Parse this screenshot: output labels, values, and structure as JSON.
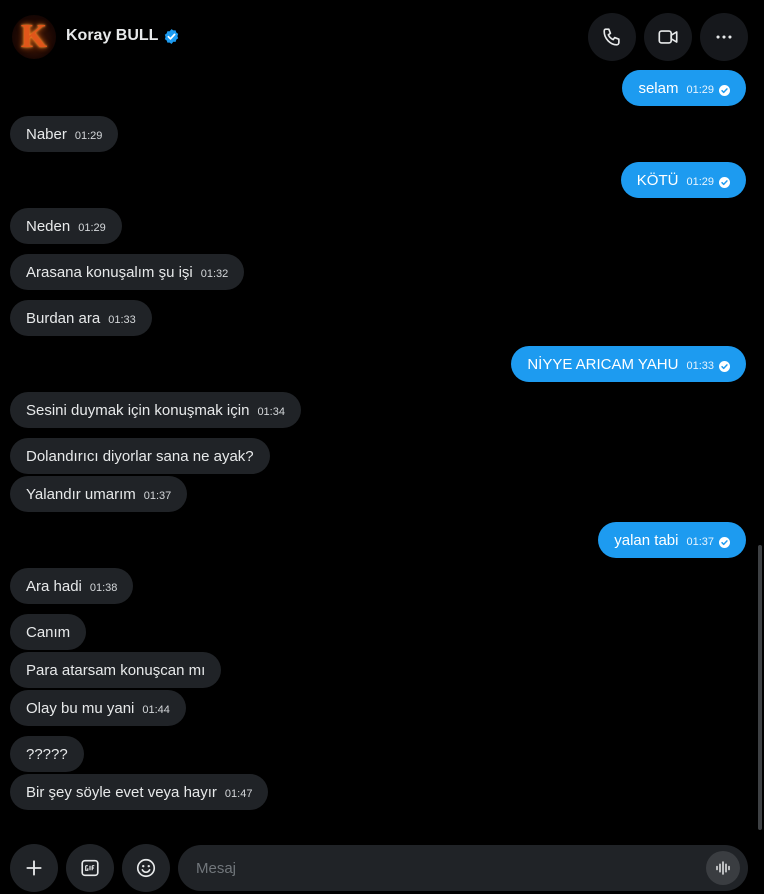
{
  "header": {
    "contact_name": "Koray BULL",
    "avatar_letter": "K"
  },
  "messages": [
    {
      "dir": "out",
      "text": "selam",
      "time": "01:29",
      "read": true
    },
    {
      "dir": "in",
      "text": "Naber",
      "time": "01:29"
    },
    {
      "dir": "out",
      "text": "KÖTÜ",
      "time": "01:29",
      "read": true
    },
    {
      "dir": "in",
      "text": "Neden",
      "time": "01:29"
    },
    {
      "dir": "in",
      "text": "Arasana konuşalım şu işi",
      "time": "01:32"
    },
    {
      "dir": "in",
      "text": "Burdan ara",
      "time": "01:33"
    },
    {
      "dir": "out",
      "text": "NİYYE ARICAM YAHU",
      "time": "01:33",
      "read": true
    },
    {
      "dir": "in",
      "text": "Sesini duymak için konuşmak için",
      "time": "01:34"
    },
    {
      "dir": "in",
      "text": "Dolandırıcı diyorlar sana ne ayak?",
      "time": ""
    },
    {
      "dir": "in",
      "text": "Yalandır umarım",
      "time": "01:37"
    },
    {
      "dir": "out",
      "text": "yalan tabi",
      "time": "01:37",
      "read": true
    },
    {
      "dir": "in",
      "text": "Ara hadi",
      "time": "01:38"
    },
    {
      "dir": "in",
      "text": "Canım",
      "time": ""
    },
    {
      "dir": "in",
      "text": "Para atarsam konuşcan mı",
      "time": ""
    },
    {
      "dir": "in",
      "text": "Olay bu mu yani",
      "time": "01:44"
    },
    {
      "dir": "in",
      "text": "?????",
      "time": ""
    },
    {
      "dir": "in",
      "text": "Bir şey söyle evet veya hayır",
      "time": "01:47"
    }
  ],
  "composer": {
    "placeholder": "Mesaj"
  },
  "colors": {
    "outgoing_bubble": "#1d9bf0",
    "incoming_bubble": "#202327",
    "verified_badge": "#1d9bf0"
  },
  "icons": [
    "phone-icon",
    "video-icon",
    "more-icon",
    "plus-icon",
    "gif-icon",
    "emoji-icon",
    "voice-icon",
    "verified-icon",
    "read-check-icon"
  ]
}
